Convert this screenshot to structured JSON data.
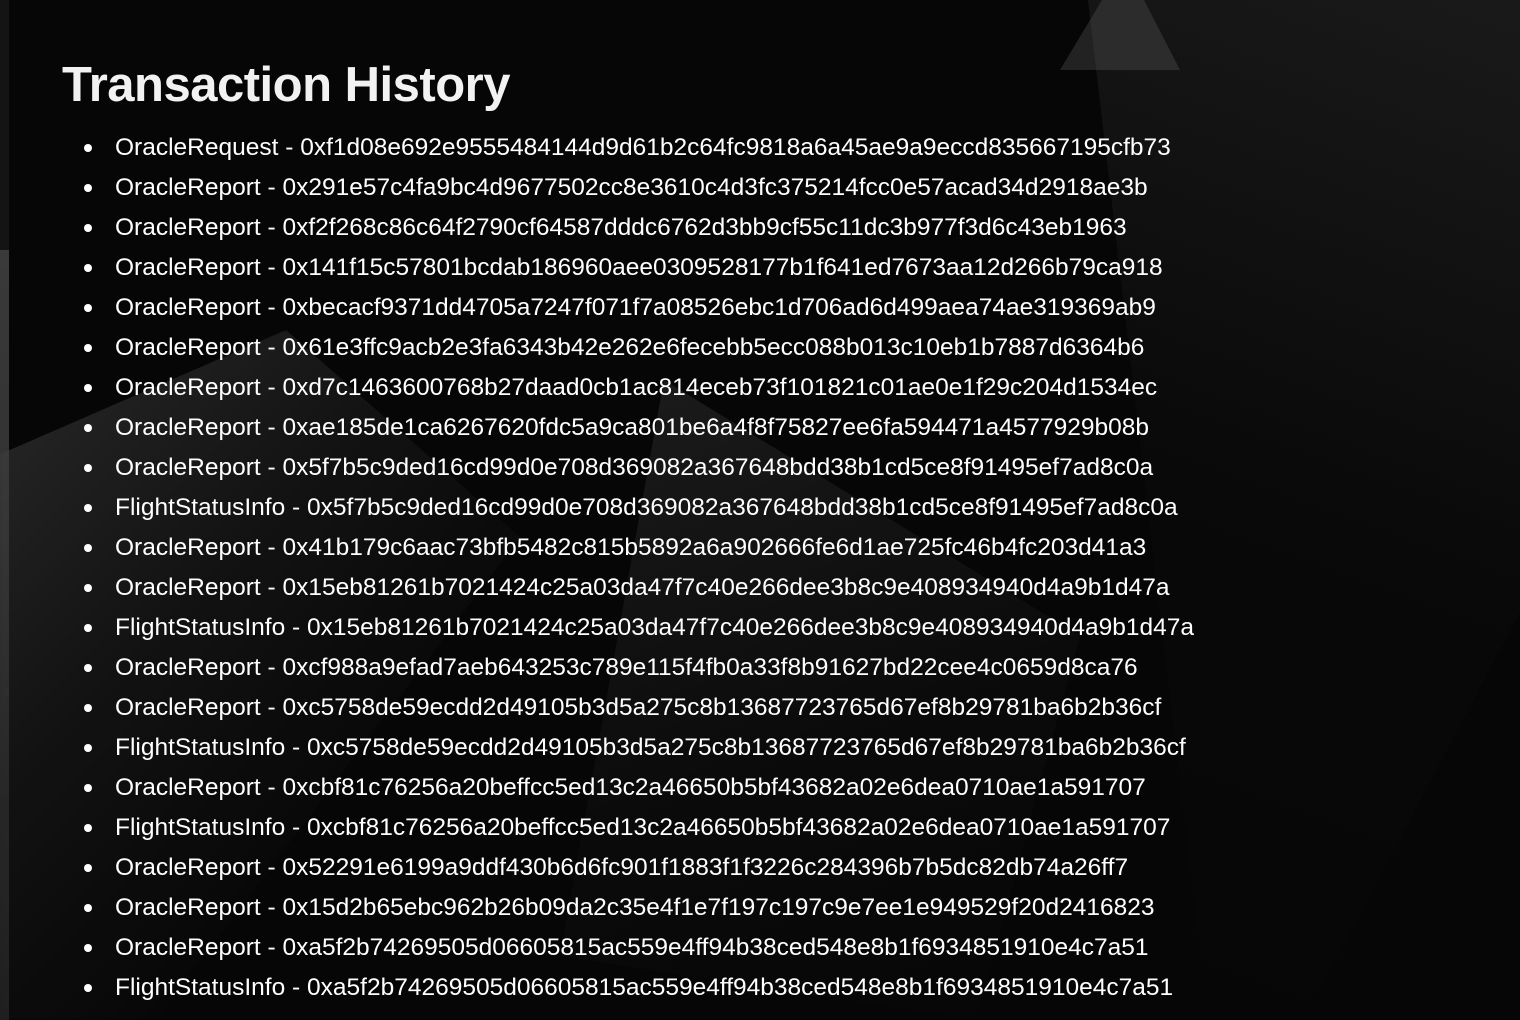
{
  "page": {
    "title": "Transaction History"
  },
  "transactions": [
    {
      "event": "OracleRequest",
      "separator": " - ",
      "hash": "0xf1d08e692e9555484144d9d61b2c64fc9818a6a45ae9a9eccd835667195cfb73"
    },
    {
      "event": "OracleReport",
      "separator": " - ",
      "hash": "0x291e57c4fa9bc4d9677502cc8e3610c4d3fc375214fcc0e57acad34d2918ae3b"
    },
    {
      "event": "OracleReport",
      "separator": " - ",
      "hash": "0xf2f268c86c64f2790cf64587dddc6762d3bb9cf55c11dc3b977f3d6c43eb1963"
    },
    {
      "event": "OracleReport",
      "separator": " - ",
      "hash": "0x141f15c57801bcdab186960aee0309528177b1f641ed7673aa12d266b79ca918"
    },
    {
      "event": "OracleReport",
      "separator": " - ",
      "hash": "0xbecacf9371dd4705a7247f071f7a08526ebc1d706ad6d499aea74ae319369ab9"
    },
    {
      "event": "OracleReport",
      "separator": " - ",
      "hash": "0x61e3ffc9acb2e3fa6343b42e262e6fecebb5ecc088b013c10eb1b7887d6364b6"
    },
    {
      "event": "OracleReport",
      "separator": " - ",
      "hash": "0xd7c1463600768b27daad0cb1ac814eceb73f101821c01ae0e1f29c204d1534ec"
    },
    {
      "event": "OracleReport",
      "separator": " - ",
      "hash": "0xae185de1ca6267620fdc5a9ca801be6a4f8f75827ee6fa594471a4577929b08b"
    },
    {
      "event": "OracleReport",
      "separator": " - ",
      "hash": "0x5f7b5c9ded16cd99d0e708d369082a367648bdd38b1cd5ce8f91495ef7ad8c0a"
    },
    {
      "event": "FlightStatusInfo",
      "separator": " - ",
      "hash": "0x5f7b5c9ded16cd99d0e708d369082a367648bdd38b1cd5ce8f91495ef7ad8c0a"
    },
    {
      "event": "OracleReport",
      "separator": " - ",
      "hash": "0x41b179c6aac73bfb5482c815b5892a6a902666fe6d1ae725fc46b4fc203d41a3"
    },
    {
      "event": "OracleReport",
      "separator": " - ",
      "hash": "0x15eb81261b7021424c25a03da47f7c40e266dee3b8c9e408934940d4a9b1d47a"
    },
    {
      "event": "FlightStatusInfo",
      "separator": " - ",
      "hash": "0x15eb81261b7021424c25a03da47f7c40e266dee3b8c9e408934940d4a9b1d47a"
    },
    {
      "event": "OracleReport",
      "separator": " - ",
      "hash": "0xcf988a9efad7aeb643253c789e115f4fb0a33f8b91627bd22cee4c0659d8ca76"
    },
    {
      "event": "OracleReport",
      "separator": " - ",
      "hash": "0xc5758de59ecdd2d49105b3d5a275c8b13687723765d67ef8b29781ba6b2b36cf"
    },
    {
      "event": "FlightStatusInfo",
      "separator": " - ",
      "hash": "0xc5758de59ecdd2d49105b3d5a275c8b13687723765d67ef8b29781ba6b2b36cf"
    },
    {
      "event": "OracleReport",
      "separator": " - ",
      "hash": "0xcbf81c76256a20beffcc5ed13c2a46650b5bf43682a02e6dea0710ae1a591707"
    },
    {
      "event": "FlightStatusInfo",
      "separator": " - ",
      "hash": "0xcbf81c76256a20beffcc5ed13c2a46650b5bf43682a02e6dea0710ae1a591707"
    },
    {
      "event": "OracleReport",
      "separator": " - ",
      "hash": "0x52291e6199a9ddf430b6d6fc901f1883f1f3226c284396b7b5dc82db74a26ff7"
    },
    {
      "event": "OracleReport",
      "separator": " - ",
      "hash": "0x15d2b65ebc962b26b09da2c35e4f1e7f197c197c9e7ee1e949529f20d2416823"
    },
    {
      "event": "OracleReport",
      "separator": " - ",
      "hash": "0xa5f2b74269505d06605815ac559e4ff94b38ced548e8b1f6934851910e4c7a51"
    },
    {
      "event": "FlightStatusInfo",
      "separator": " - ",
      "hash": "0xa5f2b74269505d06605815ac559e4ff94b38ced548e8b1f6934851910e4c7a51"
    }
  ]
}
